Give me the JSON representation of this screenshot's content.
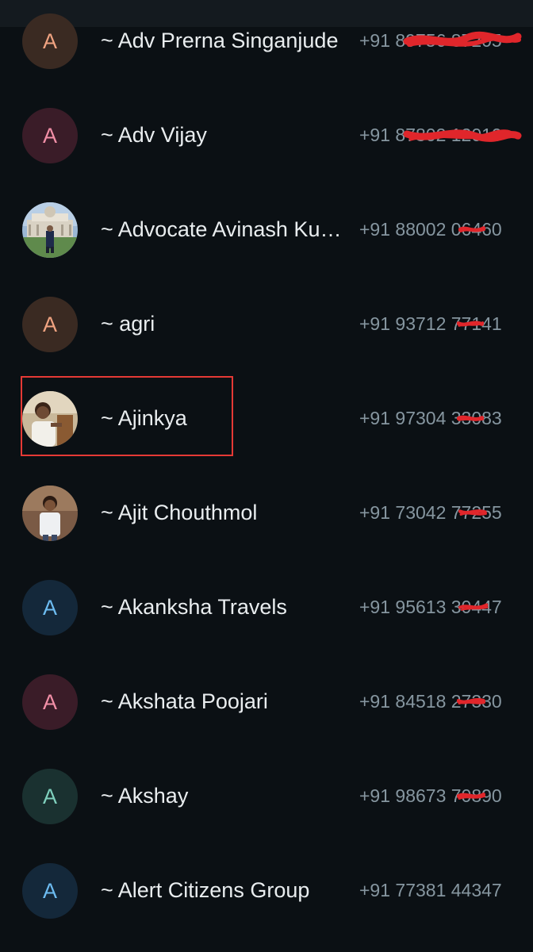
{
  "contacts": [
    {
      "initial": "A",
      "name": "~ Adv Prerna Singanjude",
      "phone": "+91 89756 87205",
      "avatar_color": "#3a2a22"
    },
    {
      "initial": "A",
      "name": "~ Adv Vijay",
      "phone": "+91 87802 12010",
      "avatar_color": "#3a1c28"
    },
    {
      "initial": "",
      "name": "~ Advocate Avinash Kumar",
      "phone": "+91 88002 06460",
      "avatar_type": "photo"
    },
    {
      "initial": "A",
      "name": "~ agri",
      "phone": "+91 93712 77141",
      "avatar_color": "#3a2a22"
    },
    {
      "initial": "",
      "name": "~ Ajinkya",
      "phone": "+91 97304 33083",
      "avatar_type": "photo",
      "highlighted": true
    },
    {
      "initial": "",
      "name": "~ Ajit Chouthmol",
      "phone": "+91 73042 77255",
      "avatar_type": "photo"
    },
    {
      "initial": "A",
      "name": "~ Akanksha Travels",
      "phone": "+91 95613 30447",
      "avatar_color": "#14283a"
    },
    {
      "initial": "A",
      "name": "~ Akshata Poojari",
      "phone": "+91 84518 27330",
      "avatar_color": "#3a1c28"
    },
    {
      "initial": "A",
      "name": "~ Akshay",
      "phone": "+91 98673 70890",
      "avatar_color": "#1a3130"
    },
    {
      "initial": "A",
      "name": "~ Alert Citizens Group",
      "phone": "+91 77381 44347",
      "avatar_color": "#14283a"
    }
  ],
  "colors": {
    "background": "#0b1014",
    "name_text": "#e9edef",
    "phone_text": "#8696a0",
    "highlight_box": "#e53935",
    "redaction": "#e0262b"
  }
}
